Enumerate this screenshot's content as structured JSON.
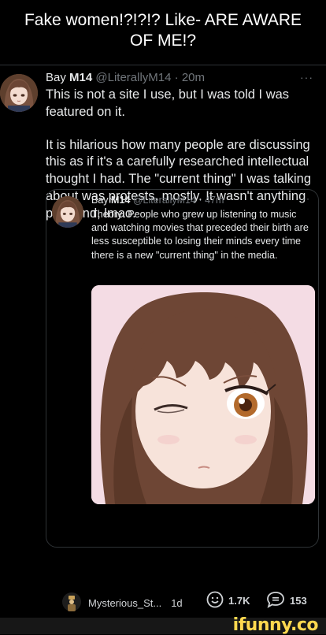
{
  "header": {
    "title_line1": "Fake women!?!?!? Like- ARE AWARE",
    "title_line2": "OF ME!?"
  },
  "tweet": {
    "display_name": "Bay",
    "display_name_bold": "M14",
    "handle": "@LiterallyM14",
    "separator": "·",
    "time": "20m",
    "more": "···",
    "paragraph1": "This is not a site I use, but I was told I was featured on it.",
    "paragraph2": "It is hilarious how many people are discussing this as if it's a carefully researched intellectual thought I had. The \"current thing\" I was talking about was protests, mostly. It wasn't anything profound, lmao."
  },
  "quote": {
    "display_name": "Bay",
    "display_name_bold": "M14",
    "handle": "@LiterallyM14",
    "separator": "·",
    "time": "47m",
    "more": "···",
    "text": "Theory: People who grew up listening to music and watching movies that preceded their birth are less susceptible to losing their minds every time there is a new \"current thing\" in the media."
  },
  "actions": {
    "user": "Mysterious_St...",
    "time": "1d",
    "likes": "1.7K",
    "comments": "153"
  },
  "watermark": {
    "text": "ifunny.co"
  },
  "colors": {
    "background": "#000000",
    "text": "#e7e9ea",
    "muted": "#71767b",
    "border": "#2f3336",
    "watermark": "#ffd84f"
  }
}
